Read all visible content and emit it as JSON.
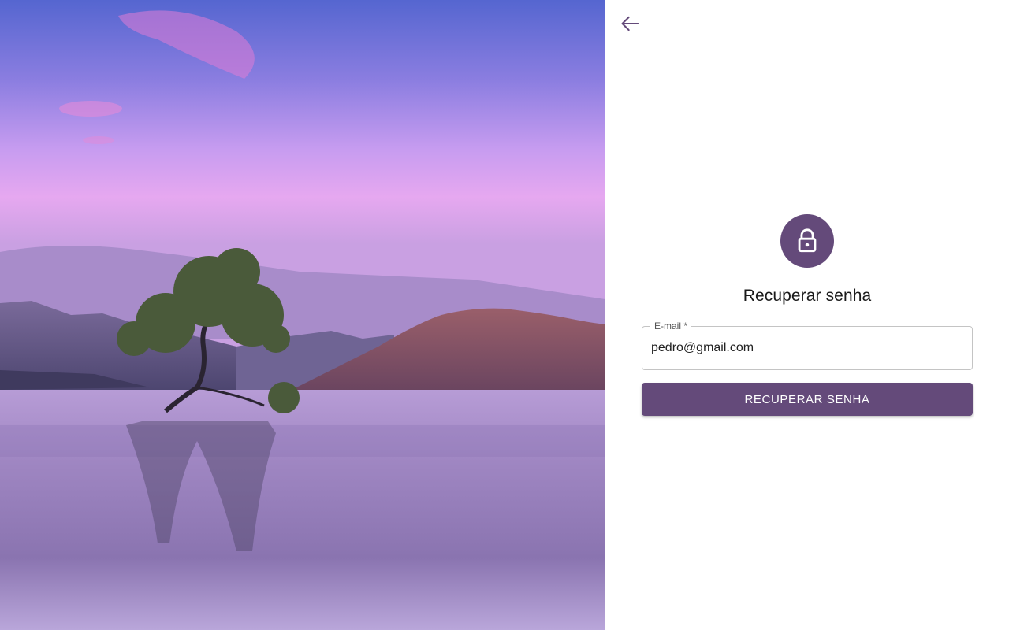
{
  "hero": {
    "image": "landscape-lake-tree-photo"
  },
  "header": {
    "back_icon": "arrow-left-icon"
  },
  "form": {
    "icon": "lock-icon",
    "title": "Recuperar senha",
    "email_label": "E-mail *",
    "email_value": "pedro@gmail.com",
    "submit_label": "RECUPERAR SENHA"
  },
  "colors": {
    "primary": "#644A7A",
    "background": "#ffffff",
    "border": "#c4c4c4"
  }
}
